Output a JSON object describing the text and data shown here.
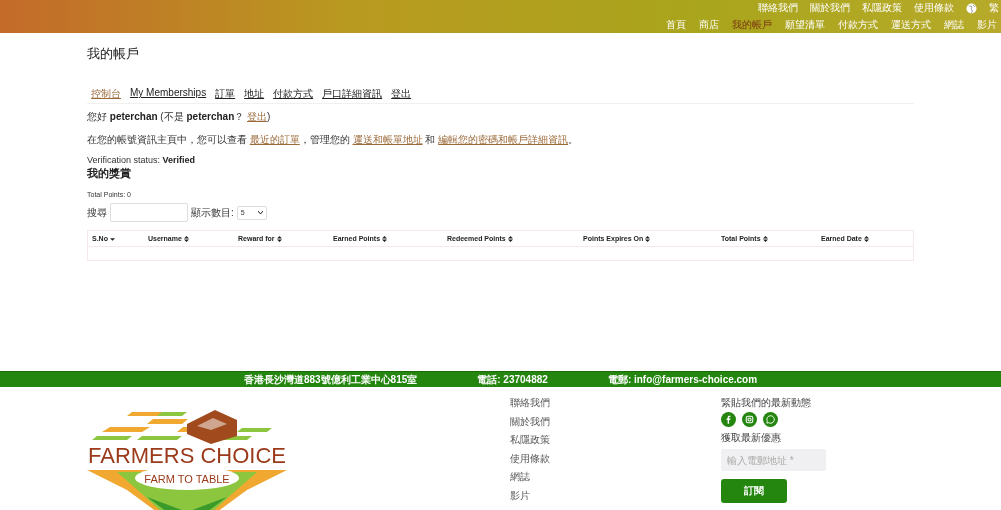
{
  "top_links": [
    "聯絡我們",
    "關於我們",
    "私隱政策",
    "使用條款"
  ],
  "language": "繁",
  "nav": [
    {
      "label": "首頁",
      "selected": false
    },
    {
      "label": "商店",
      "selected": false
    },
    {
      "label": "我的帳戶",
      "selected": true
    },
    {
      "label": "願望清單",
      "selected": false
    },
    {
      "label": "付款方式",
      "selected": false
    },
    {
      "label": "運送方式",
      "selected": false
    },
    {
      "label": "網誌",
      "selected": false
    },
    {
      "label": "影片",
      "selected": false
    }
  ],
  "page_title": "我的帳戶",
  "account_tabs": [
    {
      "label": "控制台",
      "selected": true
    },
    {
      "label": "My Memberships",
      "selected": false
    },
    {
      "label": "訂單",
      "selected": false
    },
    {
      "label": "地址",
      "selected": false
    },
    {
      "label": "付款方式",
      "selected": false
    },
    {
      "label": "戶口詳細資訊",
      "selected": false
    },
    {
      "label": "登出",
      "selected": false
    }
  ],
  "greeting": [
    {
      "text": "您好 **peterchan** (不是 **peterchan**？ ",
      "kind": "text"
    },
    {
      "text": "登出",
      "kind": "link"
    },
    {
      "text": ")",
      "kind": "text"
    }
  ],
  "intro": [
    {
      "text": "在您的帳號資訊主頁中，您可以查看 ",
      "kind": "text"
    },
    {
      "text": "最近的訂單",
      "kind": "link"
    },
    {
      "text": "，管理您的 ",
      "kind": "text"
    },
    {
      "text": "運送和帳單地址",
      "kind": "link"
    },
    {
      "text": " 和 ",
      "kind": "text"
    },
    {
      "text": "編輯您的密碼和帳戶詳細資訊",
      "kind": "link"
    },
    {
      "text": "。",
      "kind": "text"
    }
  ],
  "verification": "Verification status: **Verified**",
  "rewards": {
    "title": "我的獎賞",
    "total_points": "Total Points: 0",
    "search_label": "搜尋",
    "show_label": "顯示數目:",
    "show_value": "5",
    "columns": [
      {
        "label": "S.No",
        "sorted": true
      },
      {
        "label": "Username",
        "sorted": false
      },
      {
        "label": "Reward for",
        "sorted": false
      },
      {
        "label": "Earned Points",
        "sorted": false
      },
      {
        "label": "Redeemed Points",
        "sorted": false
      },
      {
        "label": "Points Expires On",
        "sorted": false
      },
      {
        "label": "Total Points",
        "sorted": false
      },
      {
        "label": "Earned Date",
        "sorted": false
      }
    ]
  },
  "contact_bar": [
    "香港長沙灣道883號億利工業中心815室",
    "電話: 23704882",
    "電郵: info@farmers-choice.com"
  ],
  "logo": {
    "name": "FARMERS CHOICE",
    "tagline": "FARM TO TABLE"
  },
  "footer_links": [
    "聯絡我們",
    "關於我們",
    "私隱政策",
    "使用條款",
    "網誌",
    "影片"
  ],
  "follow": {
    "title": "緊貼我們的最新動態",
    "social": [
      {
        "kind": "facebook"
      },
      {
        "kind": "instagram"
      },
      {
        "kind": "whatsapp"
      }
    ]
  },
  "newsletter": {
    "label": "獲取最新優惠",
    "placeholder": "輸入電郵地址 *",
    "button": "訂閱"
  }
}
